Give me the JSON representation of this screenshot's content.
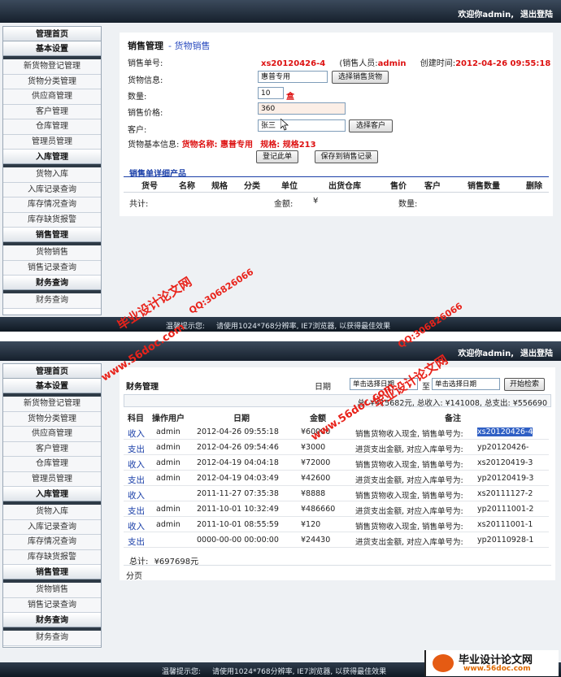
{
  "header": {
    "welcome": "欢迎你admin,",
    "logout": "退出登陆"
  },
  "sidebar": {
    "home": "管理首页",
    "groups": [
      {
        "title": "基本设置",
        "items": [
          "新货物登记管理",
          "货物分类管理",
          "供应商管理",
          "客户管理",
          "仓库管理",
          "管理员管理"
        ]
      },
      {
        "title": "入库管理",
        "items": [
          "货物入库",
          "入库记录查询",
          "库存情况查询",
          "库存缺货报警"
        ]
      },
      {
        "title": "销售管理",
        "items": [
          "货物销售",
          "销售记录查询"
        ]
      },
      {
        "title": "财务查询",
        "items": [
          "财务查询"
        ]
      }
    ]
  },
  "sales": {
    "title": "销售管理",
    "subtitle": "- 货物销售",
    "order_label": "销售单号:",
    "order_no": "xs20120426-4",
    "salesperson_label": "(销售人员:",
    "salesperson": "admin",
    "created_label": "创建时间:",
    "created_time": "2012-04-26 09:55:18",
    "goods_label": "货物信息:",
    "goods_value": "惠普专用",
    "select_goods_btn": "选择销售货物",
    "qty_label": "数量:",
    "qty_value": "10",
    "qty_unit": "盒",
    "price_label": "销售价格:",
    "price_value": "360",
    "customer_label": "客户:",
    "customer_value": "张三",
    "select_customer_btn": "选择客户",
    "basic_info_label": "货物基本信息:",
    "basic_info_name": "货物名称: 惠普专用",
    "basic_info_spec": "规格: 规格213",
    "register_btn": "登记此单",
    "save_btn": "保存到销售记录",
    "detail_title": "销售单详细产品",
    "columns": [
      "货号",
      "名称",
      "规格",
      "分类",
      "单位",
      "出货仓库",
      "售价",
      "客户",
      "销售数量",
      "删除"
    ],
    "total_label": "共计:",
    "amount_label": "金额:",
    "yen": "¥",
    "qty_total_label": "数量:"
  },
  "footer": {
    "tip_label": "温馨提示您:",
    "tip_text": "请使用1024*768分辨率, IE7浏览器, 以获得最佳效果"
  },
  "finance": {
    "title": "财务管理",
    "date_label": "日期",
    "start_placeholder": "单击选择日期",
    "to_label": "至",
    "end_placeholder": "单击选择日期",
    "search_btn": "开始检索",
    "summary": "总: ¥415682元, 总收入: ¥141008, 总支出: ¥556690",
    "columns": [
      "科目",
      "操作用户",
      "日期",
      "金额",
      "备注"
    ],
    "rows": [
      {
        "type": "收入",
        "user": "admin",
        "date": "2012-04-26 09:55:18",
        "amount": "¥60000",
        "note_prefix": "销售货物收入现金, 销售单号为:",
        "note_no": "xs20120426-4"
      },
      {
        "type": "支出",
        "user": "admin",
        "date": "2012-04-26 09:54:46",
        "amount": "¥3000",
        "note_prefix": "进货支出金额, 对应入库单号为:",
        "note_no": "yp20120426-"
      },
      {
        "type": "收入",
        "user": "admin",
        "date": "2012-04-19 04:04:18",
        "amount": "¥72000",
        "note_prefix": "销售货物收入现金, 销售单号为:",
        "note_no": "xs20120419-3"
      },
      {
        "type": "支出",
        "user": "admin",
        "date": "2012-04-19 04:03:49",
        "amount": "¥42600",
        "note_prefix": "进货支出金额, 对应入库单号为:",
        "note_no": "yp20120419-3"
      },
      {
        "type": "收入",
        "user": "",
        "date": "2011-11-27 07:35:38",
        "amount": "¥8888",
        "note_prefix": "销售货物收入现金, 销售单号为:",
        "note_no": "xs20111127-2"
      },
      {
        "type": "支出",
        "user": "admin",
        "date": "2011-10-01 10:32:49",
        "amount": "¥486660",
        "note_prefix": "进货支出金额, 对应入库单号为:",
        "note_no": "yp20111001-2"
      },
      {
        "type": "收入",
        "user": "admin",
        "date": "2011-10-01 08:55:59",
        "amount": "¥120",
        "note_prefix": "销售货物收入现金, 销售单号为:",
        "note_no": "xs20111001-1"
      },
      {
        "type": "支出",
        "user": "",
        "date": "0000-00-00 00:00:00",
        "amount": "¥24430",
        "note_prefix": "进货支出金额, 对应入库单号为:",
        "note_no": "yp20110928-1"
      }
    ],
    "total_label": "总计:",
    "total_value": "¥697698元",
    "pager": "分页"
  },
  "watermarks": {
    "site_cn": "毕业设计论文网",
    "site_url": "www.56doc.com",
    "qq": "QQ:306826066",
    "logo_big": "毕业设计论文网",
    "logo_small": "www.56doc.com"
  },
  "colors": {
    "accent_red": "#dd1111",
    "link_blue": "#1a3fa8",
    "topbar": "#1c2633",
    "watermark_red": "#e8231b"
  }
}
